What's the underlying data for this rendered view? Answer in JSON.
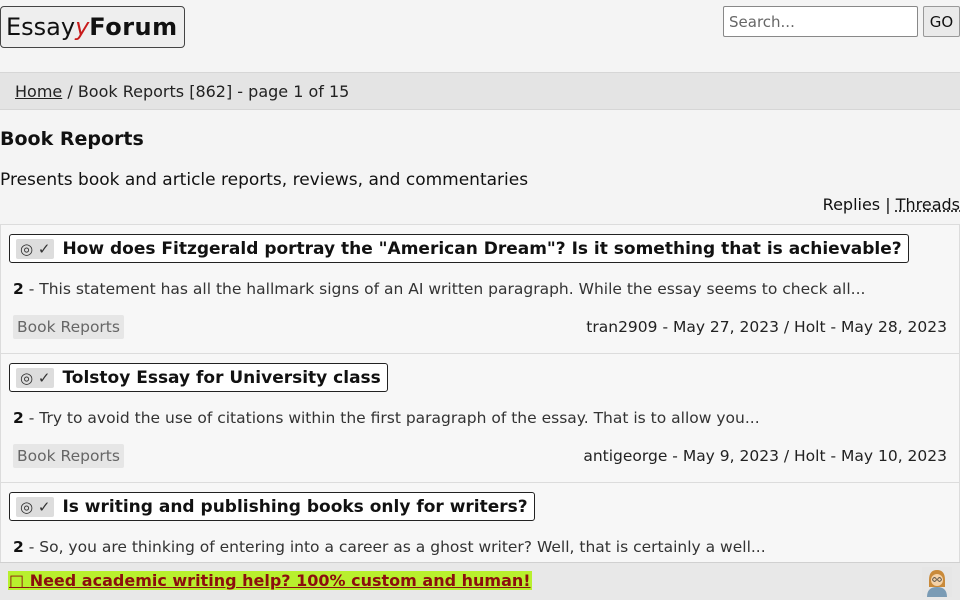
{
  "header": {
    "logo": {
      "part1": "Essay",
      "part2": "y",
      "part3": "Forum"
    },
    "search": {
      "placeholder": "Search...",
      "button_label": "GO"
    }
  },
  "breadcrumb": {
    "home": "Home",
    "separator": "/",
    "current": "Book Reports [862] - page 1 of 15"
  },
  "page": {
    "title": "Book Reports",
    "description": "Presents book and article reports, reviews, and commentaries"
  },
  "sort": {
    "replies": "Replies",
    "separator": "|",
    "threads": "Threads"
  },
  "threads": [
    {
      "badge": "◎ ✓",
      "title": "How does Fitzgerald portray the \"American Dream\"? Is it something that is achievable?",
      "count": "2",
      "excerpt": "- This statement has all the hallmark signs of an AI written paragraph. While the essay seems to check all...",
      "category": "Book Reports",
      "meta": "tran2909 - May 27, 2023 / Holt - May 28, 2023"
    },
    {
      "badge": "◎ ✓",
      "title": "Tolstoy Essay for University class",
      "count": "2",
      "excerpt": "- Try to avoid the use of citations within the first paragraph of the essay. That is to allow you...",
      "category": "Book Reports",
      "meta": "antigeorge - May 9, 2023 / Holt - May 10, 2023"
    },
    {
      "badge": "◎ ✓",
      "title": "Is writing and publishing books only for writers?",
      "count": "2",
      "excerpt": "- So, you are thinking of entering into a career as a ghost writer? Well, that is certainly a well...",
      "category": "",
      "meta": ""
    }
  ],
  "promo": {
    "text": "Need academic writing help? 100% custom and human!",
    "icon": "emoji-icon"
  },
  "colors": {
    "accent_red": "#c81b1b",
    "promo_bg": "#b8f02e",
    "promo_text": "#8b0e0e"
  }
}
